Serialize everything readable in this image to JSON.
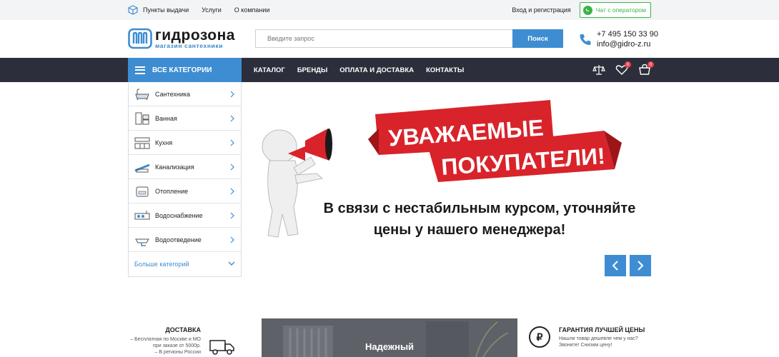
{
  "topbar": {
    "links": [
      "Пункты выдачи",
      "Услуги",
      "О компании"
    ],
    "login": "Вход и регистрация",
    "chat": "Чат с оператором"
  },
  "header": {
    "logo_name": "гидрозона",
    "logo_tag": "магазин сантехники",
    "search_placeholder": "Введите запрос",
    "search_button": "Поиск",
    "phone": "+7 495 150 33 90",
    "email": "info@gidro-z.ru"
  },
  "nav": {
    "all_categories": "ВСЕ КАТЕГОРИИ",
    "menu": [
      "КАТАЛОГ",
      "БРЕНДЫ",
      "ОПЛАТА И ДОСТАВКА",
      "КОНТАКТЫ"
    ],
    "favorites_count": "0",
    "cart_count": "0"
  },
  "sidebar": {
    "items": [
      {
        "label": "Сантехника",
        "icon": "bathtub-icon"
      },
      {
        "label": "Ванная",
        "icon": "bathroom-icon"
      },
      {
        "label": "Кухня",
        "icon": "kitchen-icon"
      },
      {
        "label": "Канализация",
        "icon": "sewer-icon"
      },
      {
        "label": "Отопление",
        "icon": "heating-icon"
      },
      {
        "label": "Водоснабжение",
        "icon": "water-supply-icon"
      },
      {
        "label": "Водоотведение",
        "icon": "drainage-icon"
      }
    ],
    "more": "Больше категорий"
  },
  "banner": {
    "ribbon_line1": "УВАЖАЕМЫЕ",
    "ribbon_line2": "ПОКУПАТЕЛИ!",
    "text_line1": "В связи с нестабильным курсом, уточняйте",
    "text_line2": "цены у нашего менеджера!"
  },
  "bottom": {
    "delivery_title": "ДОСТАВКА",
    "delivery_text1": "– Бесплатная по Москве и МО",
    "delivery_text2": "при заказе от 5000р.",
    "delivery_text3": "– В регионы России",
    "promo_label": "Надежный",
    "guarantee_title": "ГАРАНТИЯ ЛУЧШЕЙ ЦЕНЫ",
    "guarantee_text1": "Нашли товар дешевле чем у нас?",
    "guarantee_text2": "Звоните! Снизим цену!",
    "rub_symbol": "₽"
  },
  "colors": {
    "accent": "#3e8dd2",
    "nav_bg": "#2c2f3b",
    "ribbon_red": "#d8232a",
    "chat_green": "#3cb34a"
  }
}
